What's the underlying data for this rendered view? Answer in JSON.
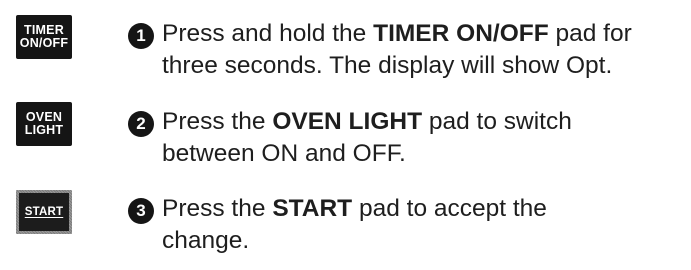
{
  "steps": [
    {
      "number": "1",
      "pad_label_line1": "TIMER",
      "pad_label_line2": "ON/OFF",
      "line1_prefix": "Press and hold the ",
      "line1_bold": "TIMER ON/OFF",
      "line1_suffix": " pad for",
      "line2": "three seconds. The display will show Opt."
    },
    {
      "number": "2",
      "pad_label_line1": "OVEN",
      "pad_label_line2": "LIGHT",
      "line1_prefix": "Press the ",
      "line1_bold": "OVEN LIGHT",
      "line1_suffix": " pad to switch",
      "line2": "between ON and OFF."
    },
    {
      "number": "3",
      "pad_label": "START",
      "line1_prefix": "Press the ",
      "line1_bold": "START",
      "line1_suffix": " pad to accept the",
      "line2": "change."
    }
  ]
}
